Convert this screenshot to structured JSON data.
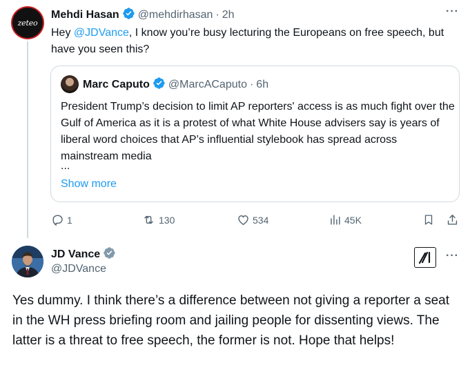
{
  "main_tweet": {
    "avatar_text": "zeteo",
    "name": "Mehdi Hasan",
    "handle": "@mehdirhasan",
    "separator": "·",
    "time": "2h",
    "text_before": "Hey ",
    "mention": "@JDVance",
    "text_after": ", I know you’re busy lecturing the Europeans on free speech, but have you seen this?",
    "more_icon": "more-dots-icon"
  },
  "quoted_tweet": {
    "name": "Marc Caputo",
    "handle": "@MarcACaputo",
    "separator": "·",
    "time": "6h",
    "text": "President Trump’s decision to limit AP reporters' access is as much fight over the Gulf of America as it is a protest of what White House advisers say is years of liberal word choices that AP’s influential stylebook has spread across mainstream media",
    "ellipsis": "...",
    "show_more": "Show more"
  },
  "actions": {
    "replies": "1",
    "reposts": "130",
    "likes": "534",
    "views": "45K"
  },
  "reply_tweet": {
    "name": "JD Vance",
    "handle": "@JDVance",
    "text": "Yes dummy. I think there’s a difference between not giving a reporter a seat in the WH press briefing room and jailing people for dissenting views. The latter is a threat to free speech, the former is not. Hope that helps!"
  },
  "colors": {
    "accent": "#1d9bf0",
    "secondary_text": "#536471",
    "verified_gray": "#829aab"
  }
}
